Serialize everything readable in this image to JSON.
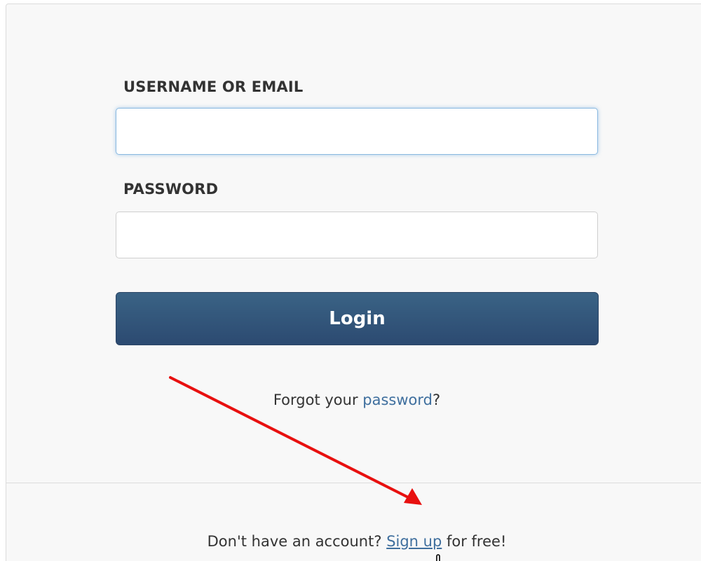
{
  "form": {
    "username_label": "USERNAME OR EMAIL",
    "username_value": "",
    "password_label": "PASSWORD",
    "password_value": "",
    "login_label": "Login"
  },
  "forgot": {
    "prefix": "Forgot your ",
    "link": "password",
    "suffix": "?"
  },
  "signup": {
    "prefix": "Don't have an account? ",
    "link": "Sign up",
    "suffix": " for free!"
  },
  "annotation": {
    "arrow_color": "#e8100f",
    "icon": "hand-pointer-cursor-icon"
  },
  "colors": {
    "button_top": "#3a6385",
    "button_bottom": "#2c4a71",
    "link": "#3f6f9e",
    "focus_border": "#8ab9e0"
  }
}
